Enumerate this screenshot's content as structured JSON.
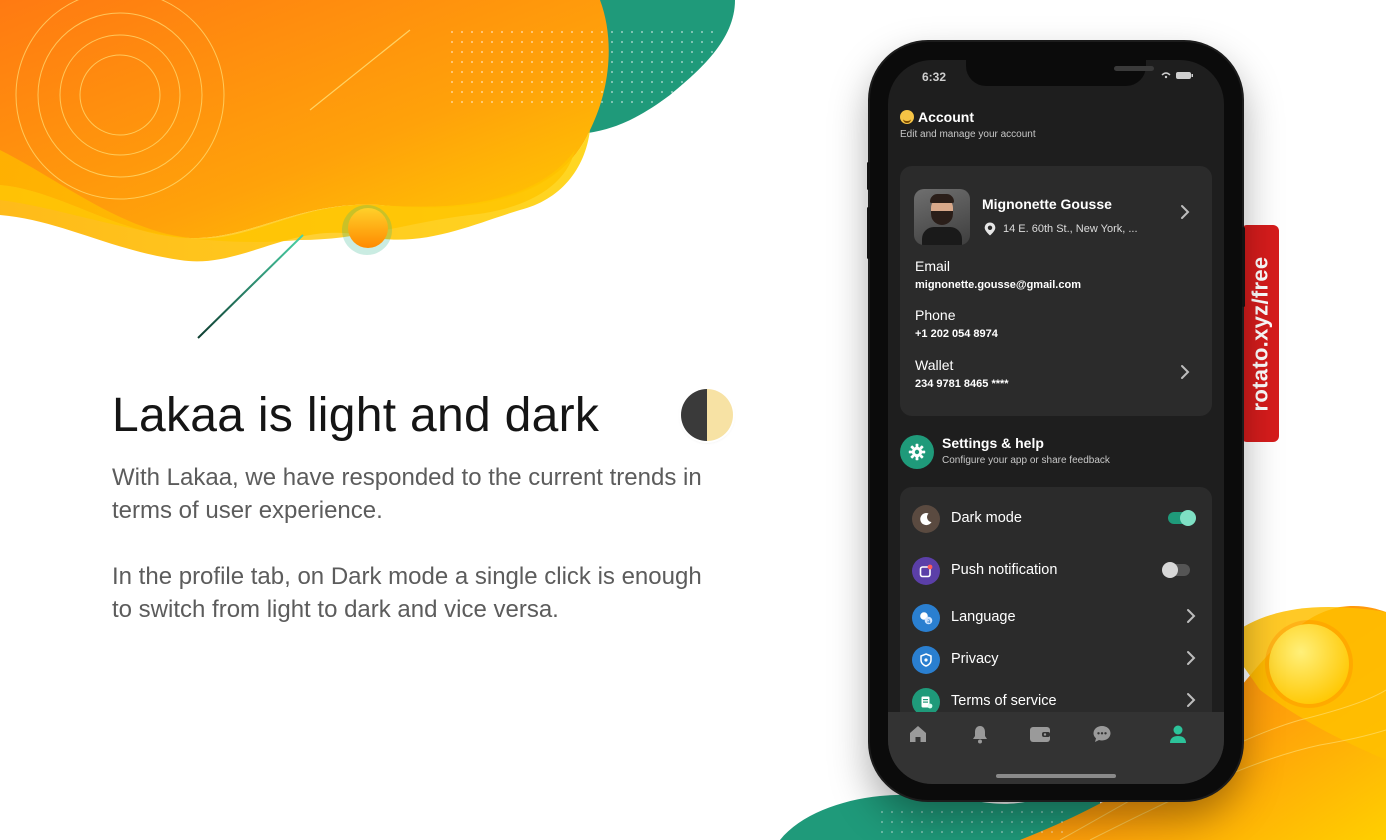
{
  "hero": {
    "headline": "Lakaa is light and dark",
    "paragraph_1": "With Lakaa, we have responded to the current trends in terms of user experience.",
    "paragraph_2": "In the profile tab, on Dark mode a single click is enough to switch from light to dark and vice versa."
  },
  "side_tag": {
    "text": "rotato.xyz/free"
  },
  "phone": {
    "status": {
      "time": "6:32"
    },
    "account": {
      "title": "Account",
      "subtitle": "Edit and manage your account"
    },
    "profile": {
      "name": "Mignonette Gousse",
      "address": "14 E. 60th St., New York, ...",
      "email_label": "Email",
      "email_value": "mignonette.gousse@gmail.com",
      "phone_label": "Phone",
      "phone_value": "+1 202 054  8974",
      "wallet_label": "Wallet",
      "wallet_value": "234 9781 8465 ****"
    },
    "settings": {
      "title": "Settings & help",
      "subtitle": "Configure your app or share feedback",
      "items": [
        {
          "label": "Dark mode",
          "icon": "moon-icon",
          "color": "#5a4a40",
          "toggle": true,
          "on": true
        },
        {
          "label": "Push notification",
          "icon": "notification-icon",
          "color": "#5b3fa8",
          "toggle": true,
          "on": false
        },
        {
          "label": "Language",
          "icon": "translate-icon",
          "color": "#2a7fd0"
        },
        {
          "label": "Privacy",
          "icon": "shield-icon",
          "color": "#2a7fd0"
        },
        {
          "label": "Terms of service",
          "icon": "document-icon",
          "color": "#1f9a7a"
        }
      ]
    },
    "tabs": [
      {
        "name": "home",
        "icon": "home-icon",
        "active": false
      },
      {
        "name": "notifications",
        "icon": "bell-icon",
        "active": false
      },
      {
        "name": "wallet",
        "icon": "wallet-icon",
        "active": false
      },
      {
        "name": "chat",
        "icon": "chat-icon",
        "active": false
      },
      {
        "name": "profile",
        "icon": "user-icon",
        "active": true
      }
    ],
    "colors": {
      "accent": "#1f9a7a",
      "screen_bg": "#1e1e1e",
      "card_bg": "#2b2b2b"
    }
  }
}
